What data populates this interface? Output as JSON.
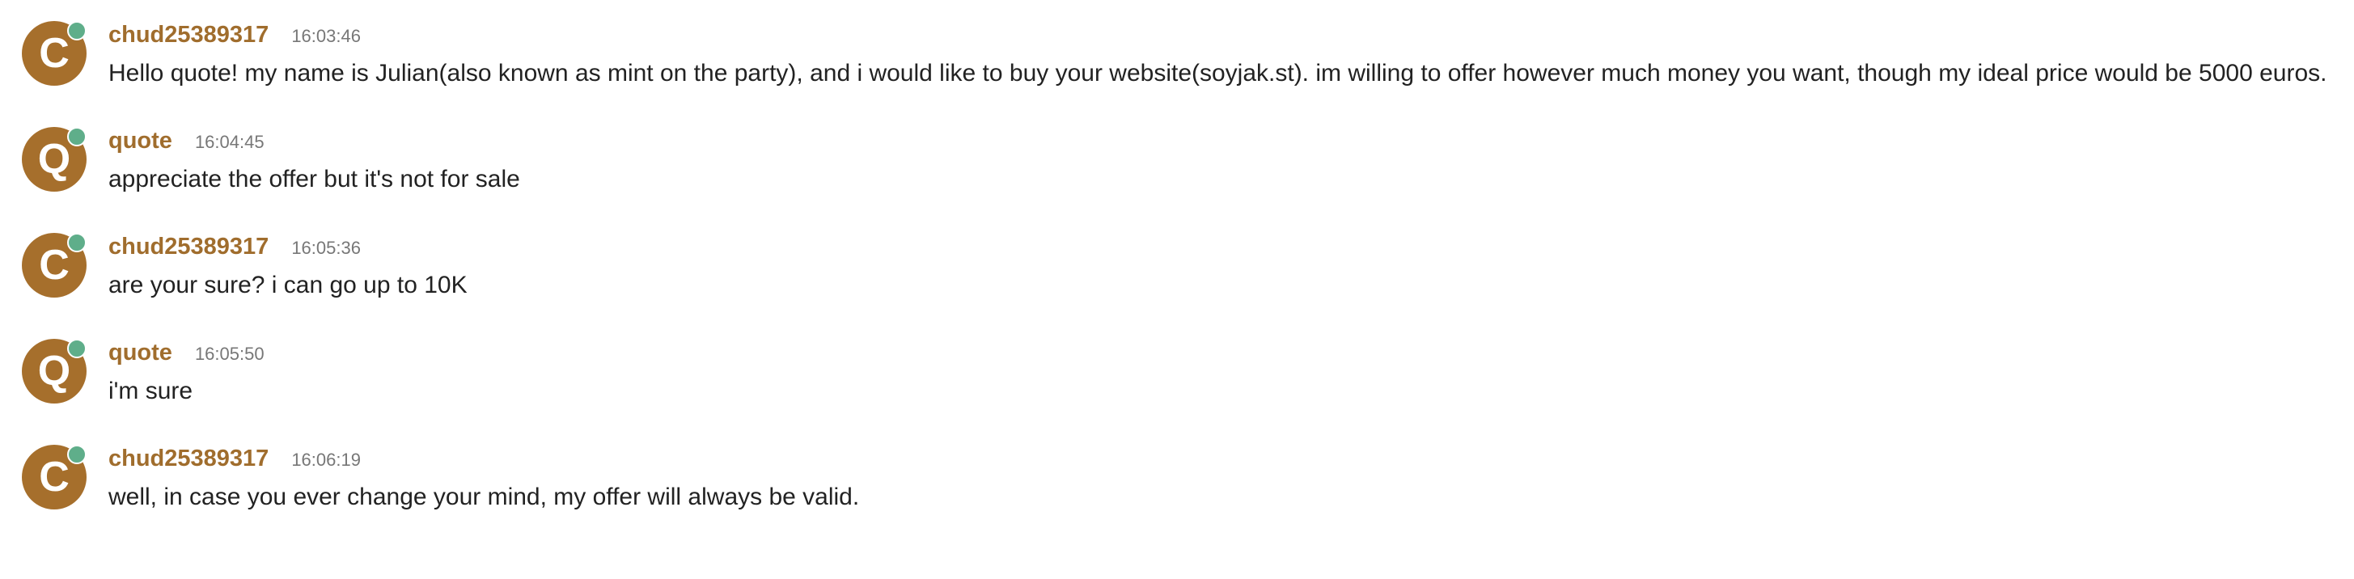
{
  "colors": {
    "avatar": "#a66f2c",
    "username": "#a06d2d",
    "online_status": "#5fae8a",
    "timestamp": "#777777",
    "text": "#222222"
  },
  "messages": [
    {
      "avatar_letter": "C",
      "username": "chud25389317",
      "time": "16:03:46",
      "text": "Hello quote! my name is Julian(also known as mint on the party), and i would like to buy your website(soyjak.st). im willing to offer however much money you want, though my ideal price would be 5000 euros."
    },
    {
      "avatar_letter": "Q",
      "username": "quote",
      "time": "16:04:45",
      "text": "appreciate the offer but it's not for sale"
    },
    {
      "avatar_letter": "C",
      "username": "chud25389317",
      "time": "16:05:36",
      "text": "are your sure? i can go up to 10K"
    },
    {
      "avatar_letter": "Q",
      "username": "quote",
      "time": "16:05:50",
      "text": "i'm sure"
    },
    {
      "avatar_letter": "C",
      "username": "chud25389317",
      "time": "16:06:19",
      "text": "well, in case you ever change your mind, my offer will always be valid."
    }
  ]
}
